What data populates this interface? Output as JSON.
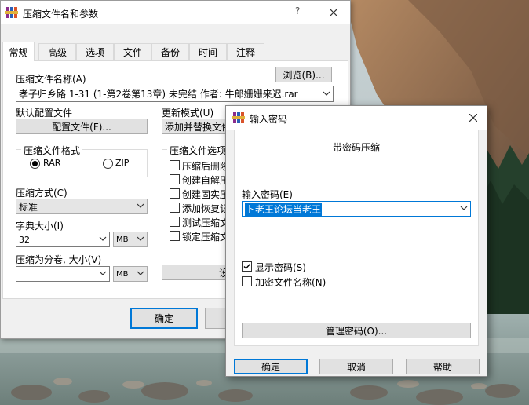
{
  "main_dialog": {
    "title": "压缩文件名和参数",
    "help_button": "?",
    "tabs": [
      "常规",
      "高级",
      "选项",
      "文件",
      "备份",
      "时间",
      "注释"
    ],
    "archive_name_label": "压缩文件名称(A)",
    "browse_button": "浏览(B)...",
    "archive_name_value": "孝子归乡路 1-31 (1-第2卷第13章) 未完结 作者: 牛郎姗姗来迟.rar",
    "default_profile_label": "默认配置文件",
    "profiles_button": "配置文件(F)...",
    "update_mode_label": "更新模式(U)",
    "update_mode_value": "添加并替换文件",
    "format_group_title": "压缩文件格式",
    "format_rar": "RAR",
    "format_zip": "ZIP",
    "archiving_options_title": "压缩文件选项",
    "options": [
      "压缩后删除",
      "创建自解压",
      "创建固实压",
      "添加恢复记",
      "测试压缩文",
      "锁定压缩文"
    ],
    "compression_method_label": "压缩方式(C)",
    "compression_method_value": "标准",
    "dictionary_size_label": "字典大小(I)",
    "dictionary_size_value": "32",
    "dictionary_unit": "MB",
    "split_volumes_label": "压缩为分卷, 大小(V)",
    "split_volumes_value": "",
    "split_unit": "MB",
    "set_password_button": "设",
    "ok_button": "确定"
  },
  "password_dialog": {
    "title": "输入密码",
    "close_icon": "close-icon",
    "heading": "带密码压缩",
    "enter_password_label": "输入密码(E)",
    "password_value": "卜老王论坛当老王",
    "show_password_label": "显示密码(S)",
    "show_password_checked": true,
    "encrypt_names_label": "加密文件名称(N)",
    "encrypt_names_checked": false,
    "organize_passwords_button": "管理密码(O)...",
    "ok_button": "确定",
    "cancel_button": "取消",
    "help_button": "帮助"
  }
}
